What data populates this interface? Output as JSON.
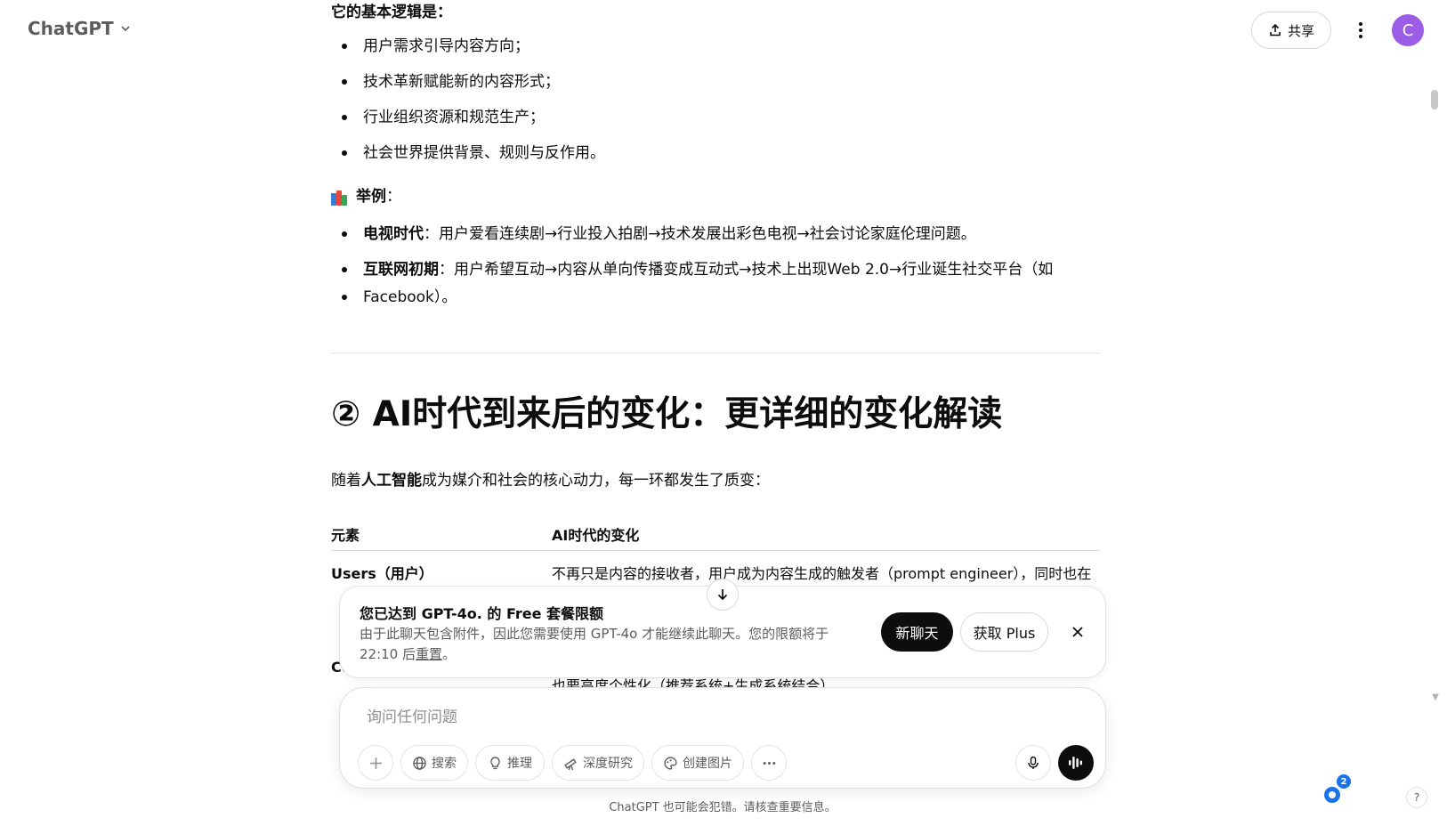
{
  "topbar": {
    "title": "ChatGPT",
    "share_label": "共享",
    "avatar_letter": "C"
  },
  "content": {
    "logic_heading": "它的基本逻辑是：",
    "logic_items": [
      "用户需求引导内容方向；",
      "技术革新赋能新的内容形式；",
      "行业组织资源和规范生产；",
      "社会世界提供背景、规则与反作用。"
    ],
    "example_label": "举例",
    "example_colon": "：",
    "examples": [
      {
        "bold": "电视时代",
        "text": "：用户爱看连续剧→行业投入拍剧→技术发展出彩色电视→社会讨论家庭伦理问题。"
      },
      {
        "bold": "互联网初期",
        "text": "：用户希望互动→内容从单向传播变成互动式→技术上出现Web 2.0→行业诞生社交平台（如",
        "text2": "Facebook）。"
      }
    ],
    "section_title": "② AI时代到来后的变化：更详细的变化解读",
    "intro_pre": "随着",
    "intro_bold": "人工智能",
    "intro_post": "成为媒介和社会的核心动力，每一环都发生了质变：",
    "table": {
      "headers": [
        "元素",
        "AI时代的变化"
      ],
      "rows": [
        {
          "element": "Users（用户）",
          "change": "不再只是内容的接收者，用户成为内容生成的触发者（prompt engineer），同时也在"
        },
        {
          "element": "Co",
          "change": "也要高度个性化（推荐系统+生成系统结合）"
        }
      ]
    }
  },
  "limit_banner": {
    "title": "您已达到 GPT-4o. 的 Free 套餐限额",
    "text": "由于此聊天包含附件，因此您需要使用 GPT-4o 才能继续此聊天。您的限额将于 22:10 后",
    "reset_link": "重置",
    "text_end": "。",
    "new_chat_label": "新聊天",
    "get_plus_label": "获取 Plus"
  },
  "composer": {
    "placeholder": "询问任何问题",
    "tools": [
      "搜索",
      "推理",
      "深度研究",
      "创建图片"
    ]
  },
  "footer_note": "ChatGPT 也可能会犯错。请核查重要信息。",
  "notification_count": "2",
  "help_label": "?",
  "colors": {
    "accent_avatar": "#9b5de5",
    "primary_button": "#0d0d0d",
    "badge": "#1a73e8"
  }
}
